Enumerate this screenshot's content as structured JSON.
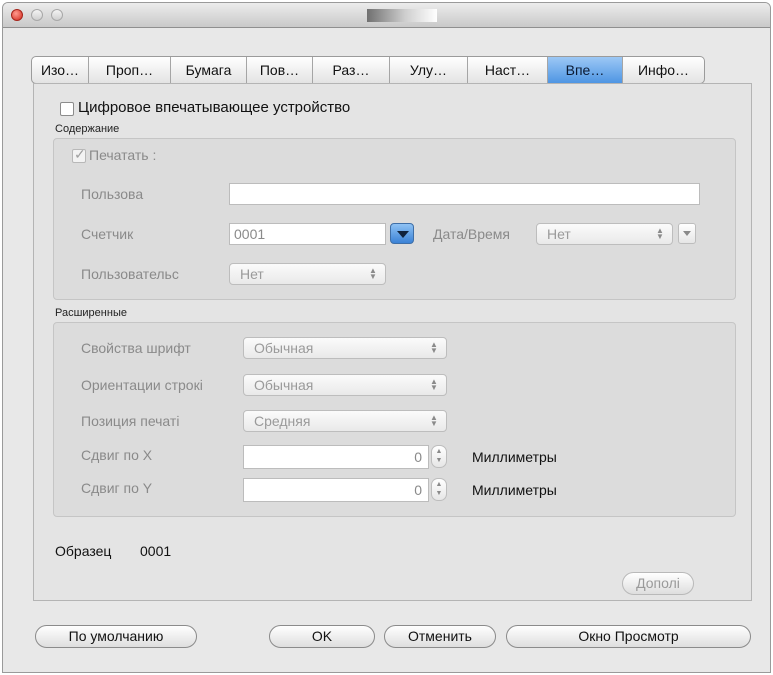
{
  "tabs": [
    {
      "label": "Изо…",
      "active": false
    },
    {
      "label": "Проп…",
      "active": false
    },
    {
      "label": "Бумага",
      "active": false
    },
    {
      "label": "Пов…",
      "active": false
    },
    {
      "label": "Раз…",
      "active": false
    },
    {
      "label": "Улу…",
      "active": false
    },
    {
      "label": "Наст…",
      "active": false
    },
    {
      "label": "Впе…",
      "active": true
    },
    {
      "label": "Инфо…",
      "active": false
    }
  ],
  "imprinter": {
    "checkbox_label": "Цифровое впечатывающее устройство",
    "checked": false
  },
  "contents": {
    "group_label": "Содержание",
    "print_checkbox_label": "Печатать :",
    "print_checked": true,
    "user_label": "Пользова",
    "user_value": "",
    "counter_label": "Счетчик",
    "counter_value": "0001",
    "datetime_label": "Дата/Время",
    "datetime_value": "Нет",
    "user_select_label": "Пользовательс",
    "user_select_value": "Нет"
  },
  "advanced": {
    "group_label": "Расширенные",
    "font_label": "Свойства шрифт",
    "font_value": "Обычная",
    "orientation_label": "Ориентации строкі",
    "orientation_value": "Обычная",
    "position_label": "Позиция печаті",
    "position_value": "Средняя",
    "shift_x_label": "Сдвиг по X",
    "shift_x_value": "0",
    "shift_x_unit": "Миллиметры",
    "shift_y_label": "Сдвиг по Y",
    "shift_y_value": "0",
    "shift_y_unit": "Миллиметры"
  },
  "sample": {
    "label": "Образец",
    "value": "0001"
  },
  "more_button": "Дополі",
  "footer": {
    "defaults": "По умолчанию",
    "ok": "OK",
    "cancel": "Отменить",
    "preview": "Окно Просмотр"
  },
  "colors": {
    "accent": "#4e95e3",
    "close": "#d2281c"
  }
}
